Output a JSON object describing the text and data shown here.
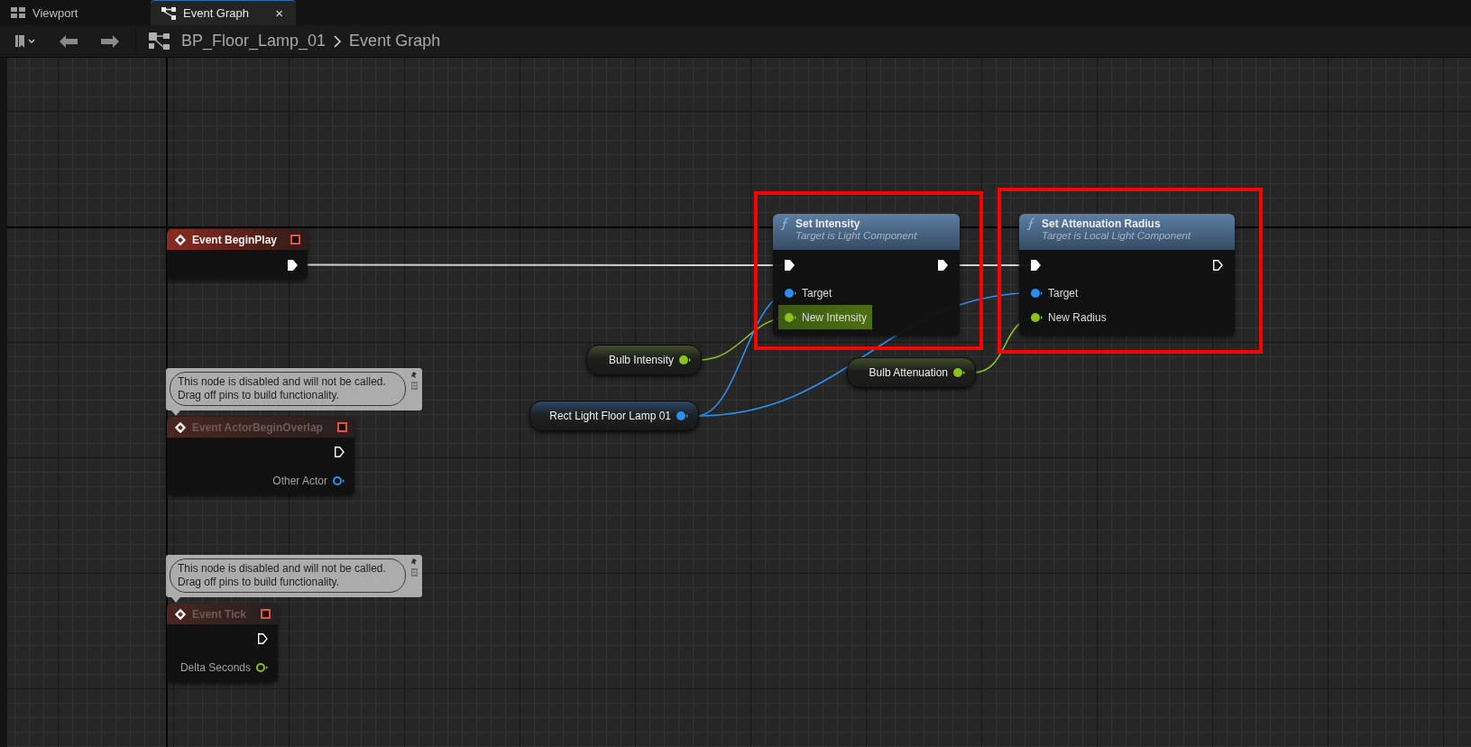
{
  "tabs": [
    {
      "label": "Viewport",
      "selected": false
    },
    {
      "label": "Event Graph",
      "selected": true,
      "close": "×"
    }
  ],
  "toolbar": {
    "breadcrumb": [
      "BP_Floor_Lamp_01",
      "Event Graph"
    ]
  },
  "nodes": [
    {
      "kind": "event",
      "title": "Event BeginPlay",
      "disabled": false,
      "pins": [
        {
          "kind": "exec",
          "linked": true
        }
      ]
    },
    {
      "kind": "comment",
      "lines": [
        "This node is disabled and will not be called.",
        "Drag off pins to build functionality."
      ]
    },
    {
      "kind": "event",
      "title": "Event ActorBeginOverlap",
      "disabled": true,
      "pins": [
        {
          "kind": "exec",
          "linked": false
        },
        {
          "kind": "object",
          "label": "Other Actor",
          "linked": false
        }
      ]
    },
    {
      "kind": "comment",
      "lines": [
        "This node is disabled and will not be called.",
        "Drag off pins to build functionality."
      ]
    },
    {
      "kind": "event",
      "title": "Event Tick",
      "disabled": true,
      "pins": [
        {
          "kind": "exec",
          "linked": false
        },
        {
          "kind": "float",
          "label": "Delta Seconds",
          "linked": false
        }
      ]
    },
    {
      "kind": "function",
      "title": "Set Intensity",
      "subtitle": "Target is Light Component",
      "pins": [
        {
          "kind": "exec",
          "linked": true
        },
        {
          "kind": "exec",
          "linked": true
        },
        {
          "kind": "object",
          "label": "Target",
          "linked": true,
          "highlighted": false
        },
        {
          "kind": "float",
          "label": "New Intensity",
          "linked": true,
          "highlighted": true
        }
      ]
    },
    {
      "kind": "function",
      "title": "Set Attenuation Radius",
      "subtitle": "Target is Local Light Component",
      "pins": [
        {
          "kind": "exec",
          "linked": true
        },
        {
          "kind": "exec",
          "linked": false
        },
        {
          "kind": "object",
          "label": "Target",
          "linked": true,
          "highlighted": false
        },
        {
          "kind": "float",
          "label": "New Radius",
          "linked": true,
          "highlighted": false
        }
      ]
    },
    {
      "kind": "variable",
      "label": "Bulb Intensity",
      "pins": [
        {
          "kind": "float",
          "linked": true
        }
      ]
    },
    {
      "kind": "variable",
      "label": "Bulb Attenuation",
      "pins": [
        {
          "kind": "float",
          "linked": true
        }
      ]
    },
    {
      "kind": "variable",
      "label": "Rect Light Floor Lamp 01",
      "pins": [
        {
          "kind": "object",
          "linked": true
        }
      ]
    }
  ]
}
